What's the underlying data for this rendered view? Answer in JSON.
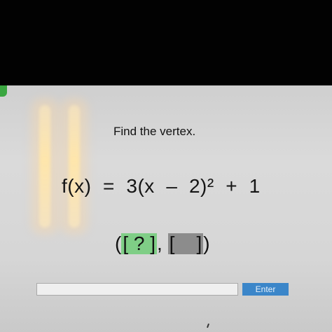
{
  "prompt": {
    "title": "Find the vertex."
  },
  "equation": {
    "text": "f(x)  =  3(x  –  2)²  +  1"
  },
  "answer": {
    "open": "(",
    "first_box": "[ ? ]",
    "comma": ", ",
    "second_box": "[    ]",
    "close": ")"
  },
  "input": {
    "value": "",
    "placeholder": ""
  },
  "enter_button": {
    "label": "Enter"
  },
  "colors": {
    "panel": "#d6d6d6",
    "active_box": "#7fce86",
    "inactive_box": "#8c8c8c",
    "enter_button": "#3b86c9",
    "status_tab": "#3aa640"
  }
}
